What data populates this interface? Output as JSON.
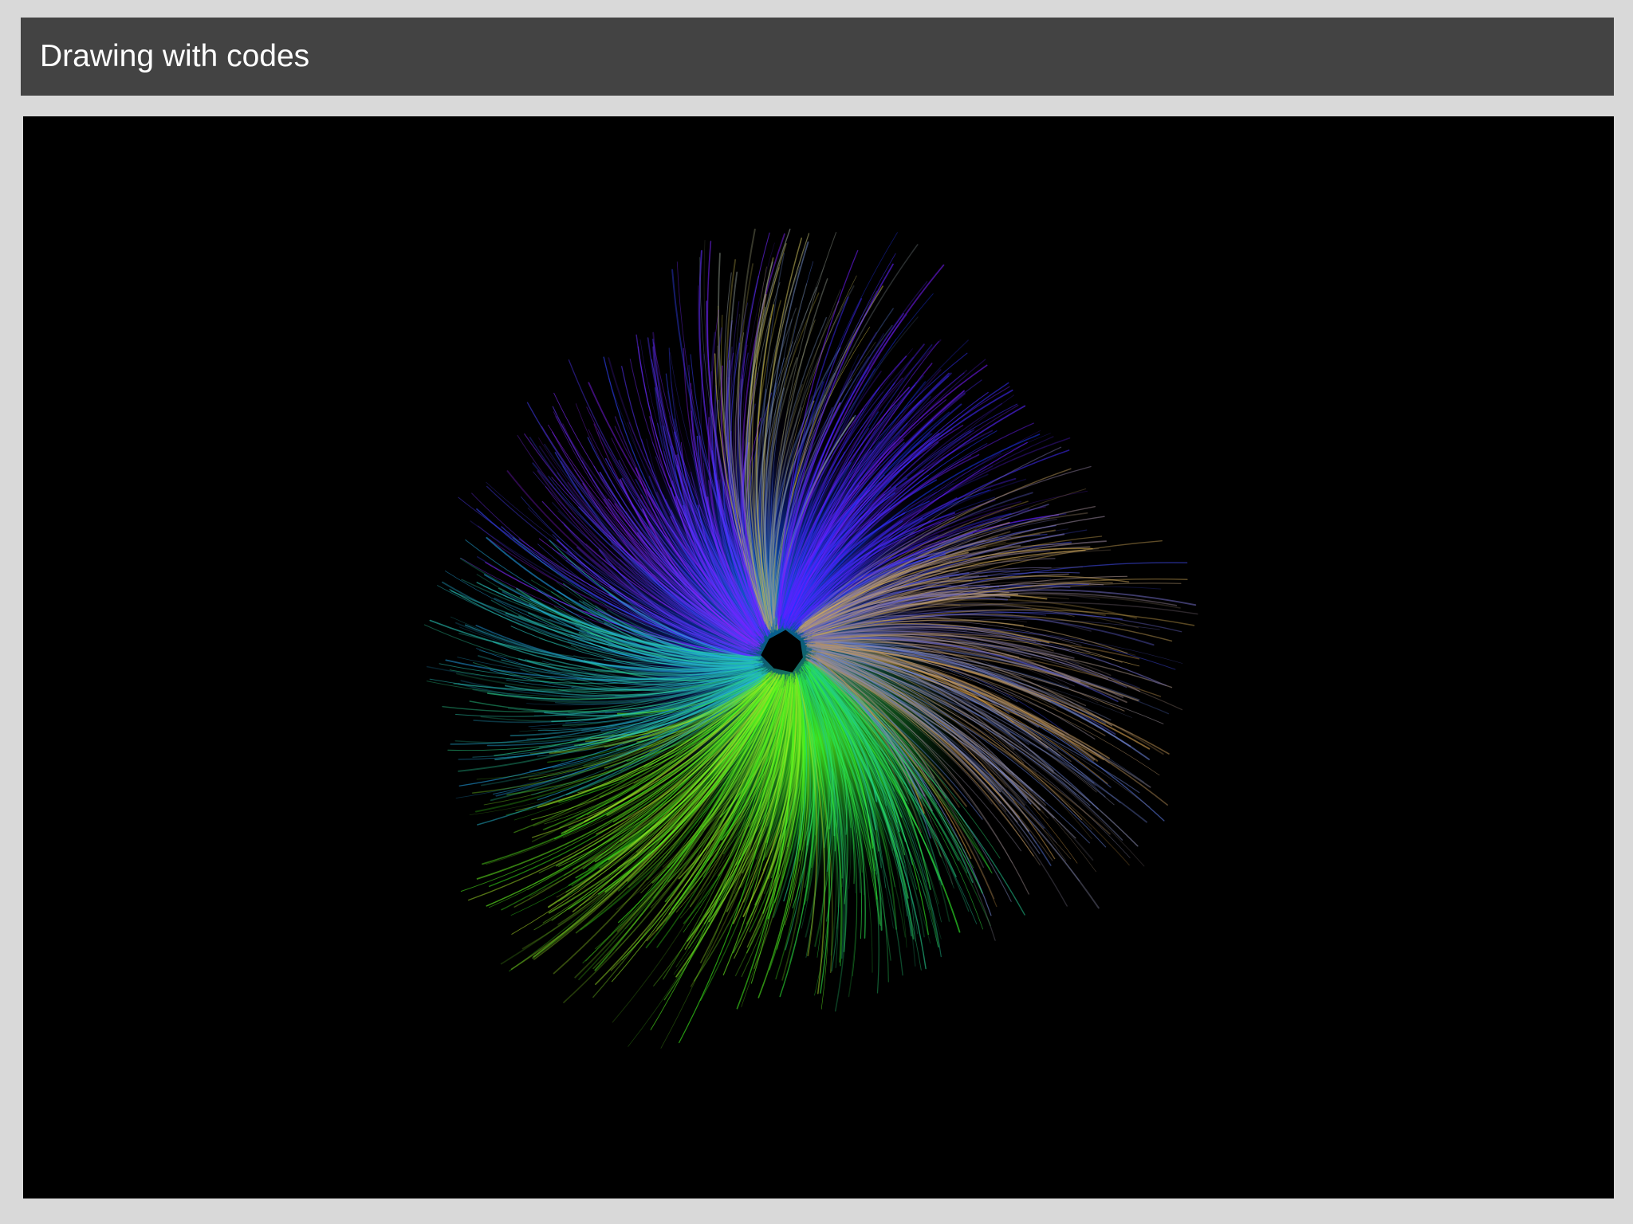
{
  "app": {
    "title": "Drawing with codes"
  },
  "artwork": {
    "description_icon": "radial-color-burst-drawing",
    "palette": {
      "background": "#000000",
      "hues": [
        "#0a2cff",
        "#1f7bff",
        "#7a1aff",
        "#c02cff",
        "#3cff12",
        "#a8ff12",
        "#d9c23a",
        "#ff9a3c",
        "#23d8a8"
      ],
      "core": "#000000"
    }
  }
}
